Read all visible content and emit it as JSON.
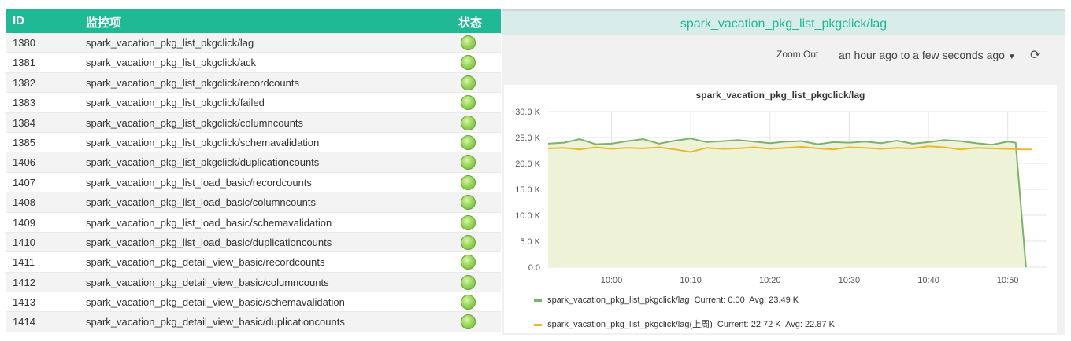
{
  "table": {
    "headers": {
      "id": "ID",
      "item": "监控项",
      "status": "状态"
    },
    "rows": [
      {
        "id": "1380",
        "name": "spark_vacation_pkg_list_pkgclick/lag"
      },
      {
        "id": "1381",
        "name": "spark_vacation_pkg_list_pkgclick/ack"
      },
      {
        "id": "1382",
        "name": "spark_vacation_pkg_list_pkgclick/recordcounts"
      },
      {
        "id": "1383",
        "name": "spark_vacation_pkg_list_pkgclick/failed"
      },
      {
        "id": "1384",
        "name": "spark_vacation_pkg_list_pkgclick/columncounts"
      },
      {
        "id": "1385",
        "name": "spark_vacation_pkg_list_pkgclick/schemavalidation"
      },
      {
        "id": "1406",
        "name": "spark_vacation_pkg_list_pkgclick/duplicationcounts"
      },
      {
        "id": "1407",
        "name": "spark_vacation_pkg_list_load_basic/recordcounts"
      },
      {
        "id": "1408",
        "name": "spark_vacation_pkg_list_load_basic/columncounts"
      },
      {
        "id": "1409",
        "name": "spark_vacation_pkg_list_load_basic/schemavalidation"
      },
      {
        "id": "1410",
        "name": "spark_vacation_pkg_list_load_basic/duplicationcounts"
      },
      {
        "id": "1411",
        "name": "spark_vacation_pkg_detail_view_basic/recordcounts"
      },
      {
        "id": "1412",
        "name": "spark_vacation_pkg_detail_view_basic/columncounts"
      },
      {
        "id": "1413",
        "name": "spark_vacation_pkg_detail_view_basic/schemavalidation"
      },
      {
        "id": "1414",
        "name": "spark_vacation_pkg_detail_view_basic/duplicationcounts"
      }
    ],
    "status_color": "#8fd14f"
  },
  "panel": {
    "title": "spark_vacation_pkg_list_pkgclick/lag",
    "zoom_out": "Zoom Out",
    "time_range": "an hour ago to a few seconds ago",
    "caret_icon": "caret-down-icon",
    "refresh_icon": "refresh-icon"
  },
  "chart_data": {
    "type": "line",
    "title": "spark_vacation_pkg_list_pkgclick/lag",
    "y_ticks": [
      "0.0",
      "5.0 K",
      "10.0 K",
      "15.0 K",
      "20.0 K",
      "25.0 K",
      "30.0 K"
    ],
    "ylim": [
      0,
      30000
    ],
    "x_ticks": [
      "10:00",
      "10:10",
      "10:20",
      "10:30",
      "10:40",
      "10:50"
    ],
    "x_range_minutes": [
      -8,
      55
    ],
    "grid": true,
    "series": [
      {
        "name": "spark_vacation_pkg_list_pkgclick/lag",
        "color": "#7cb36b",
        "current": "Current: 0.00",
        "avg": "Avg: 23.49 K",
        "x": [
          -8,
          -6,
          -4,
          -2,
          0,
          2,
          4,
          6,
          8,
          10,
          12,
          14,
          16,
          18,
          20,
          22,
          24,
          26,
          28,
          30,
          32,
          34,
          36,
          38,
          40,
          42,
          44,
          46,
          48,
          50,
          51,
          52.3
        ],
        "values": [
          23800,
          24000,
          24700,
          23700,
          23800,
          24300,
          24700,
          23800,
          24400,
          24800,
          24100,
          24300,
          24500,
          24200,
          23900,
          24200,
          24300,
          23700,
          24100,
          24000,
          24200,
          23900,
          24400,
          23800,
          24100,
          24500,
          24300,
          23900,
          23600,
          24200,
          24000,
          0
        ]
      },
      {
        "name": "spark_vacation_pkg_list_pkgclick/lag(上周)",
        "color": "#e8b92f",
        "current": "Current: 22.72 K",
        "avg": "Avg: 22.87 K",
        "x": [
          -8,
          -6,
          -4,
          -2,
          0,
          2,
          4,
          6,
          8,
          10,
          12,
          14,
          16,
          18,
          20,
          22,
          24,
          26,
          28,
          30,
          32,
          34,
          36,
          38,
          40,
          42,
          44,
          46,
          48,
          50,
          52,
          53
        ],
        "values": [
          22900,
          23000,
          22700,
          23100,
          22800,
          23000,
          22900,
          23100,
          22700,
          22200,
          23000,
          22800,
          22900,
          23100,
          22800,
          23000,
          23200,
          22900,
          22700,
          23100,
          23000,
          22800,
          23000,
          22900,
          23300,
          23100,
          22700,
          23000,
          22900,
          22800,
          22700,
          22700
        ]
      }
    ]
  }
}
